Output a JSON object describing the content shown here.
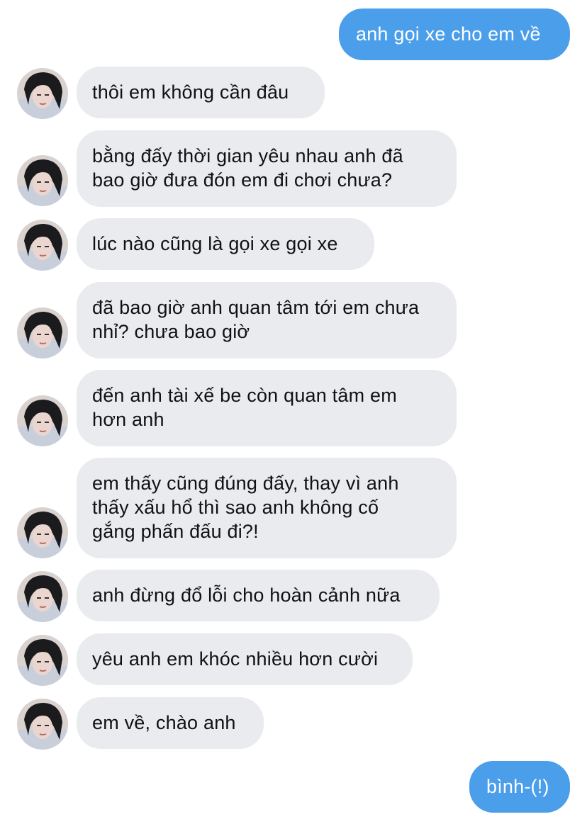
{
  "conversation": {
    "messages": [
      {
        "sender": "self",
        "text": "anh gọi xe cho em về"
      },
      {
        "sender": "other",
        "text": "thôi em không cần đâu"
      },
      {
        "sender": "other",
        "text": "bằng đấy thời gian yêu nhau anh đã\nbao giờ đưa đón em đi chơi chưa?"
      },
      {
        "sender": "other",
        "text": "lúc nào cũng là gọi xe gọi xe"
      },
      {
        "sender": "other",
        "text": "đã bao giờ anh quan tâm tới em chưa\nnhỉ? chưa bao giờ"
      },
      {
        "sender": "other",
        "text": "đến anh tài xế be còn quan tâm em\nhơn anh"
      },
      {
        "sender": "other",
        "text": "em thấy cũng đúng đấy, thay vì anh\nthấy xấu hổ thì sao anh không cố\ngắng phấn đấu đi?!"
      },
      {
        "sender": "other",
        "text": "anh đừng đổ lỗi cho hoàn cảnh nữa"
      },
      {
        "sender": "other",
        "text": "yêu anh em khóc nhiều hơn cười"
      },
      {
        "sender": "other",
        "text": "em về, chào anh"
      },
      {
        "sender": "self",
        "text": "bình-(!)"
      }
    ]
  },
  "colors": {
    "outgoing_bubble": "#4a9eea",
    "incoming_bubble": "#e9ebef",
    "outgoing_text": "#ffffff",
    "incoming_text": "#111111"
  },
  "icons": {
    "contact_avatar": "profile-photo"
  }
}
